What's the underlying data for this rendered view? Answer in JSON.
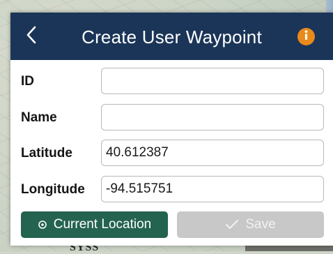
{
  "header": {
    "title": "Create User Waypoint"
  },
  "form": {
    "id_label": "ID",
    "id_value": "",
    "name_label": "Name",
    "name_value": "",
    "latitude_label": "Latitude",
    "latitude_value": "40.612387",
    "longitude_label": "Longitude",
    "longitude_value": "-94.515751"
  },
  "actions": {
    "current_location_label": "Current Location",
    "save_label": "Save"
  },
  "map": {
    "label": "SYSS"
  },
  "colors": {
    "header_bg": "#1b3558",
    "info_icon": "#e98a1b",
    "current_location_button": "#24634f",
    "save_button_disabled": "#c8c8c8"
  },
  "icons": {
    "back": "chevron-left-icon",
    "info": "info-icon",
    "location": "location-target-icon",
    "save": "checkmark-icon"
  }
}
